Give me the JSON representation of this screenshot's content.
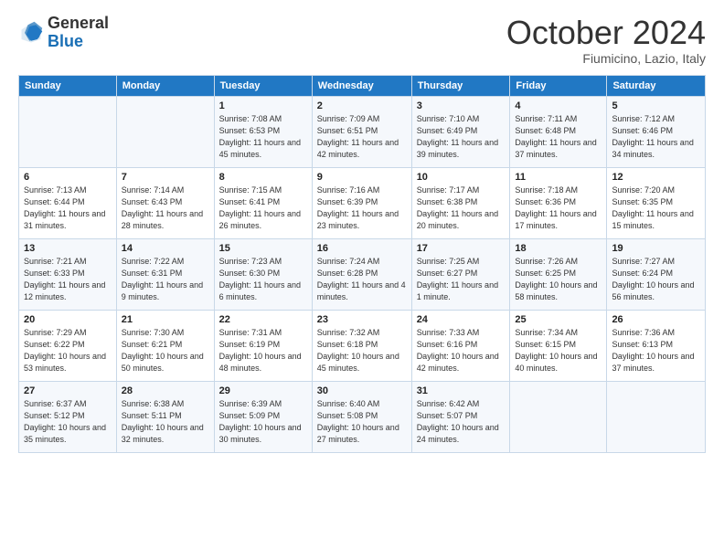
{
  "header": {
    "logo_general": "General",
    "logo_blue": "Blue",
    "month_title": "October 2024",
    "location": "Fiumicino, Lazio, Italy"
  },
  "days_of_week": [
    "Sunday",
    "Monday",
    "Tuesday",
    "Wednesday",
    "Thursday",
    "Friday",
    "Saturday"
  ],
  "weeks": [
    [
      {
        "day": "",
        "info": ""
      },
      {
        "day": "",
        "info": ""
      },
      {
        "day": "1",
        "info": "Sunrise: 7:08 AM\nSunset: 6:53 PM\nDaylight: 11 hours and 45 minutes."
      },
      {
        "day": "2",
        "info": "Sunrise: 7:09 AM\nSunset: 6:51 PM\nDaylight: 11 hours and 42 minutes."
      },
      {
        "day": "3",
        "info": "Sunrise: 7:10 AM\nSunset: 6:49 PM\nDaylight: 11 hours and 39 minutes."
      },
      {
        "day": "4",
        "info": "Sunrise: 7:11 AM\nSunset: 6:48 PM\nDaylight: 11 hours and 37 minutes."
      },
      {
        "day": "5",
        "info": "Sunrise: 7:12 AM\nSunset: 6:46 PM\nDaylight: 11 hours and 34 minutes."
      }
    ],
    [
      {
        "day": "6",
        "info": "Sunrise: 7:13 AM\nSunset: 6:44 PM\nDaylight: 11 hours and 31 minutes."
      },
      {
        "day": "7",
        "info": "Sunrise: 7:14 AM\nSunset: 6:43 PM\nDaylight: 11 hours and 28 minutes."
      },
      {
        "day": "8",
        "info": "Sunrise: 7:15 AM\nSunset: 6:41 PM\nDaylight: 11 hours and 26 minutes."
      },
      {
        "day": "9",
        "info": "Sunrise: 7:16 AM\nSunset: 6:39 PM\nDaylight: 11 hours and 23 minutes."
      },
      {
        "day": "10",
        "info": "Sunrise: 7:17 AM\nSunset: 6:38 PM\nDaylight: 11 hours and 20 minutes."
      },
      {
        "day": "11",
        "info": "Sunrise: 7:18 AM\nSunset: 6:36 PM\nDaylight: 11 hours and 17 minutes."
      },
      {
        "day": "12",
        "info": "Sunrise: 7:20 AM\nSunset: 6:35 PM\nDaylight: 11 hours and 15 minutes."
      }
    ],
    [
      {
        "day": "13",
        "info": "Sunrise: 7:21 AM\nSunset: 6:33 PM\nDaylight: 11 hours and 12 minutes."
      },
      {
        "day": "14",
        "info": "Sunrise: 7:22 AM\nSunset: 6:31 PM\nDaylight: 11 hours and 9 minutes."
      },
      {
        "day": "15",
        "info": "Sunrise: 7:23 AM\nSunset: 6:30 PM\nDaylight: 11 hours and 6 minutes."
      },
      {
        "day": "16",
        "info": "Sunrise: 7:24 AM\nSunset: 6:28 PM\nDaylight: 11 hours and 4 minutes."
      },
      {
        "day": "17",
        "info": "Sunrise: 7:25 AM\nSunset: 6:27 PM\nDaylight: 11 hours and 1 minute."
      },
      {
        "day": "18",
        "info": "Sunrise: 7:26 AM\nSunset: 6:25 PM\nDaylight: 10 hours and 58 minutes."
      },
      {
        "day": "19",
        "info": "Sunrise: 7:27 AM\nSunset: 6:24 PM\nDaylight: 10 hours and 56 minutes."
      }
    ],
    [
      {
        "day": "20",
        "info": "Sunrise: 7:29 AM\nSunset: 6:22 PM\nDaylight: 10 hours and 53 minutes."
      },
      {
        "day": "21",
        "info": "Sunrise: 7:30 AM\nSunset: 6:21 PM\nDaylight: 10 hours and 50 minutes."
      },
      {
        "day": "22",
        "info": "Sunrise: 7:31 AM\nSunset: 6:19 PM\nDaylight: 10 hours and 48 minutes."
      },
      {
        "day": "23",
        "info": "Sunrise: 7:32 AM\nSunset: 6:18 PM\nDaylight: 10 hours and 45 minutes."
      },
      {
        "day": "24",
        "info": "Sunrise: 7:33 AM\nSunset: 6:16 PM\nDaylight: 10 hours and 42 minutes."
      },
      {
        "day": "25",
        "info": "Sunrise: 7:34 AM\nSunset: 6:15 PM\nDaylight: 10 hours and 40 minutes."
      },
      {
        "day": "26",
        "info": "Sunrise: 7:36 AM\nSunset: 6:13 PM\nDaylight: 10 hours and 37 minutes."
      }
    ],
    [
      {
        "day": "27",
        "info": "Sunrise: 6:37 AM\nSunset: 5:12 PM\nDaylight: 10 hours and 35 minutes."
      },
      {
        "day": "28",
        "info": "Sunrise: 6:38 AM\nSunset: 5:11 PM\nDaylight: 10 hours and 32 minutes."
      },
      {
        "day": "29",
        "info": "Sunrise: 6:39 AM\nSunset: 5:09 PM\nDaylight: 10 hours and 30 minutes."
      },
      {
        "day": "30",
        "info": "Sunrise: 6:40 AM\nSunset: 5:08 PM\nDaylight: 10 hours and 27 minutes."
      },
      {
        "day": "31",
        "info": "Sunrise: 6:42 AM\nSunset: 5:07 PM\nDaylight: 10 hours and 24 minutes."
      },
      {
        "day": "",
        "info": ""
      },
      {
        "day": "",
        "info": ""
      }
    ]
  ]
}
